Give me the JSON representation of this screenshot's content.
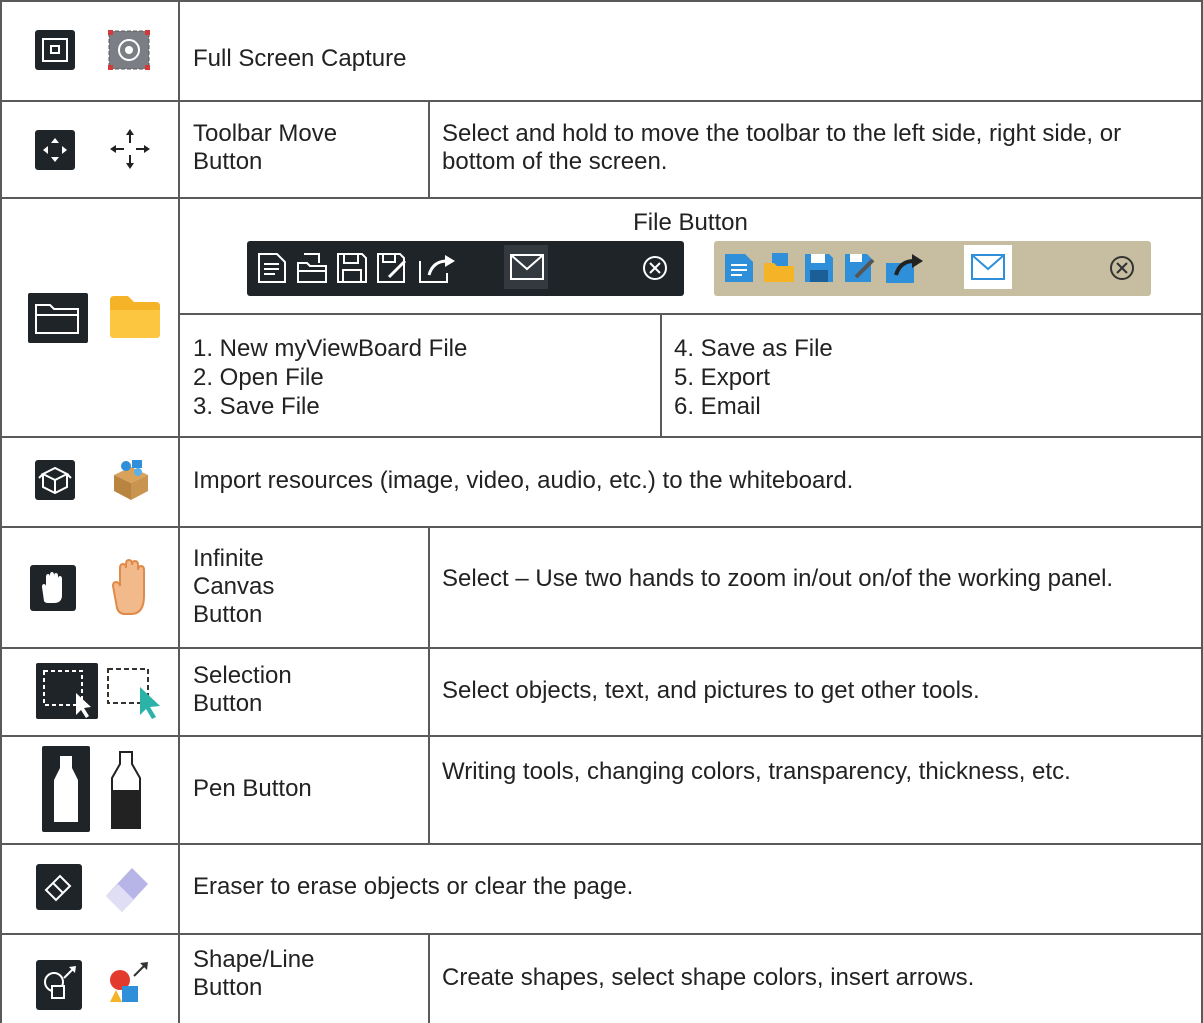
{
  "rows": {
    "fullscreen": {
      "label": "Full Screen Capture",
      "icons": [
        "capture-dark-icon",
        "capture-light-icon"
      ]
    },
    "move": {
      "label": "Toolbar Move\nButton",
      "desc": "Select and hold to move the toolbar to the left side, right side, or bottom of the screen.",
      "icons": [
        "move-dark-icon",
        "move-light-icon"
      ]
    },
    "file": {
      "title": "File Button",
      "icons": [
        "folder-dark-icon",
        "folder-light-icon"
      ],
      "items_left": "1. New myViewBoard File\n2. Open File\n3. Save File",
      "items_right": "4. Save as File\n5. Export\n6. Email",
      "toolbar_icons": [
        "new-file-icon",
        "open-file-icon",
        "save-file-icon",
        "save-as-file-icon",
        "export-icon",
        "email-icon",
        "close-icon"
      ]
    },
    "import": {
      "label": "Import resources (image, video, audio, etc.) to the whiteboard.",
      "icons": [
        "box-dark-icon",
        "box-light-icon"
      ]
    },
    "infinite": {
      "label": "Infinite\nCanvas\nButton",
      "desc": "Select – Use two hands to zoom in/out on/of the working panel.",
      "icons": [
        "hand-dark-icon",
        "hand-light-icon"
      ]
    },
    "selection": {
      "label": "Selection\nButton",
      "desc": "Select objects, text, and pictures to get other tools.",
      "icons": [
        "selection-dark-icon",
        "selection-light-icon"
      ]
    },
    "pen": {
      "label": "Pen Button",
      "desc": "Writing tools, changing colors, transparency, thickness, etc.",
      "icons": [
        "pen-dark-icon",
        "pen-light-icon"
      ]
    },
    "eraser": {
      "label": "Eraser to erase objects or clear the page.",
      "icons": [
        "eraser-dark-icon",
        "eraser-light-icon"
      ]
    },
    "shape": {
      "label": "Shape/Line\nButton",
      "desc": "Create shapes, select shape colors, insert arrows.",
      "icons": [
        "shape-dark-icon",
        "shape-light-icon"
      ]
    }
  },
  "colors": {
    "border": "#5a5a5a",
    "dark_toolbar": "#1f2429",
    "light_toolbar": "#c7bda0",
    "folder": "#f5b428",
    "accent_blue": "#2f8fd8",
    "hand": "#f2b98a"
  }
}
